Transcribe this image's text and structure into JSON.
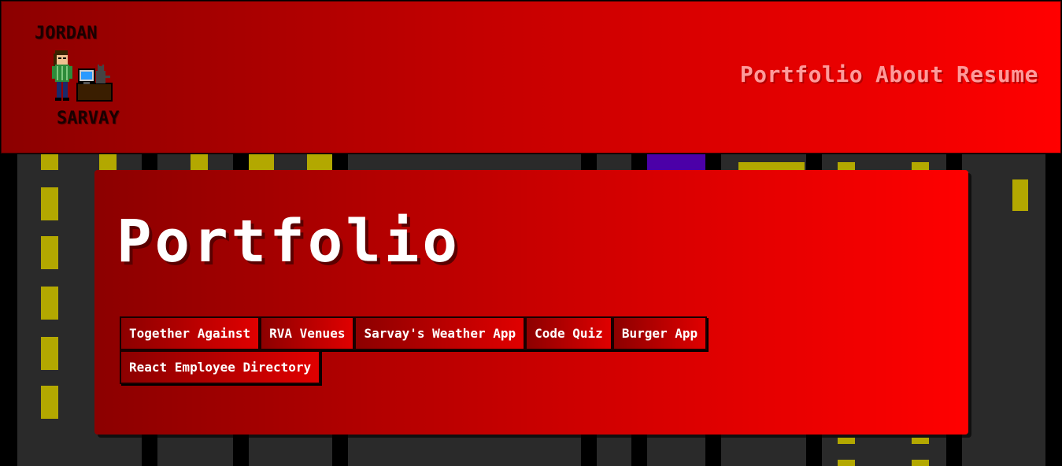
{
  "site": {
    "logo_top": "JORDAN",
    "logo_bottom": "SARVAY"
  },
  "nav": {
    "items": [
      {
        "label": "Portfolio"
      },
      {
        "label": "About"
      },
      {
        "label": "Resume"
      }
    ]
  },
  "main": {
    "title": "Portfolio",
    "projects": [
      {
        "label": "Together Against"
      },
      {
        "label": "RVA Venues"
      },
      {
        "label": "Sarvay's Weather App"
      },
      {
        "label": "Code Quiz"
      },
      {
        "label": "Burger App"
      },
      {
        "label": "React Employee Directory"
      }
    ]
  },
  "colors": {
    "header_start": "#8c0000",
    "header_end": "#ff0000",
    "nav_text": "#ff9a9a",
    "road": "#2a2a2a",
    "lane_marking": "#b3a800",
    "accent_purple": "#4b00a8"
  }
}
